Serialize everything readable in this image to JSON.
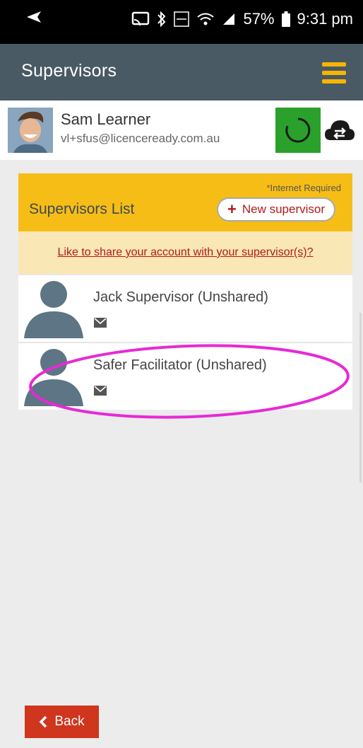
{
  "status_bar": {
    "battery": "57%",
    "time": "9:31 pm",
    "icons": [
      "send-icon",
      "cast-icon",
      "bluetooth-icon",
      "volte-icon",
      "wifi-icon",
      "signal-icon",
      "battery-icon"
    ]
  },
  "app_bar": {
    "title": "Supervisors",
    "menu_icon": "hamburger-menu-icon",
    "accent_color": "#f7b500"
  },
  "user": {
    "name": "Sam Learner",
    "email": "vl+sfus@licenceready.com.au",
    "sync_status_color": "#2aa12a"
  },
  "panel": {
    "title": "Supervisors List",
    "internet_note_star": "*",
    "internet_note": "Internet Required",
    "new_button_label": "New supervisor",
    "share_link": "Like to share your account with your supervisor(s)?"
  },
  "supervisors": [
    {
      "name": "Jack Supervisor (Unshared)"
    },
    {
      "name": "Safer Facilitator (Unshared)"
    }
  ],
  "footer": {
    "back_label": "Back",
    "back_color": "#d0351e"
  }
}
